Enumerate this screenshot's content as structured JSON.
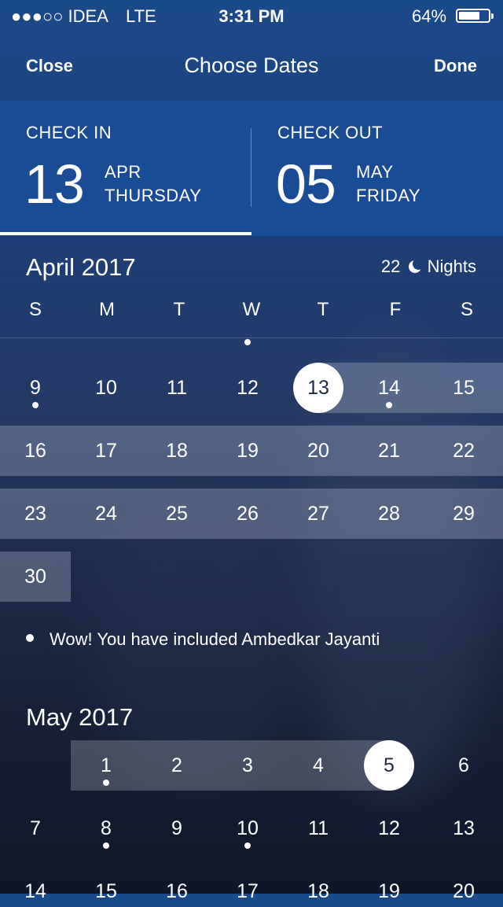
{
  "status_bar": {
    "carrier": "●●●○○ IDEA",
    "network": "LTE",
    "time": "3:31 PM",
    "battery": "64%"
  },
  "nav": {
    "close_label": "Close",
    "title": "Choose Dates",
    "done_label": "Done"
  },
  "check_in": {
    "label": "CHECK IN",
    "day": "13",
    "month": "APR",
    "weekday": "THURSDAY"
  },
  "check_out": {
    "label": "CHECK OUT",
    "day": "05",
    "month": "MAY",
    "weekday": "FRIDAY"
  },
  "april": {
    "title": "April 2017",
    "nights_count": "22",
    "nights_label": "Nights",
    "weekdays": [
      "S",
      "M",
      "T",
      "W",
      "T",
      "F",
      "S"
    ],
    "rows": [
      [
        "9",
        "10",
        "11",
        "12",
        "13",
        "14",
        "15"
      ],
      [
        "16",
        "17",
        "18",
        "19",
        "20",
        "21",
        "22"
      ],
      [
        "23",
        "24",
        "25",
        "26",
        "27",
        "28",
        "29"
      ],
      [
        "30"
      ]
    ]
  },
  "holiday_note": "Wow! You have included Ambedkar Jayanti",
  "may": {
    "title": "May 2017",
    "rows": [
      [
        "",
        "1",
        "2",
        "3",
        "4",
        "5",
        "6"
      ],
      [
        "7",
        "8",
        "9",
        "10",
        "11",
        "12",
        "13"
      ],
      [
        "14",
        "15",
        "16",
        "17",
        "18",
        "19",
        "20"
      ]
    ]
  },
  "colors": {
    "panel": "#1a4c95",
    "selected_circle": "#ffffff",
    "selected_text": "#1c2a45",
    "range_band": "#a0aac3"
  }
}
